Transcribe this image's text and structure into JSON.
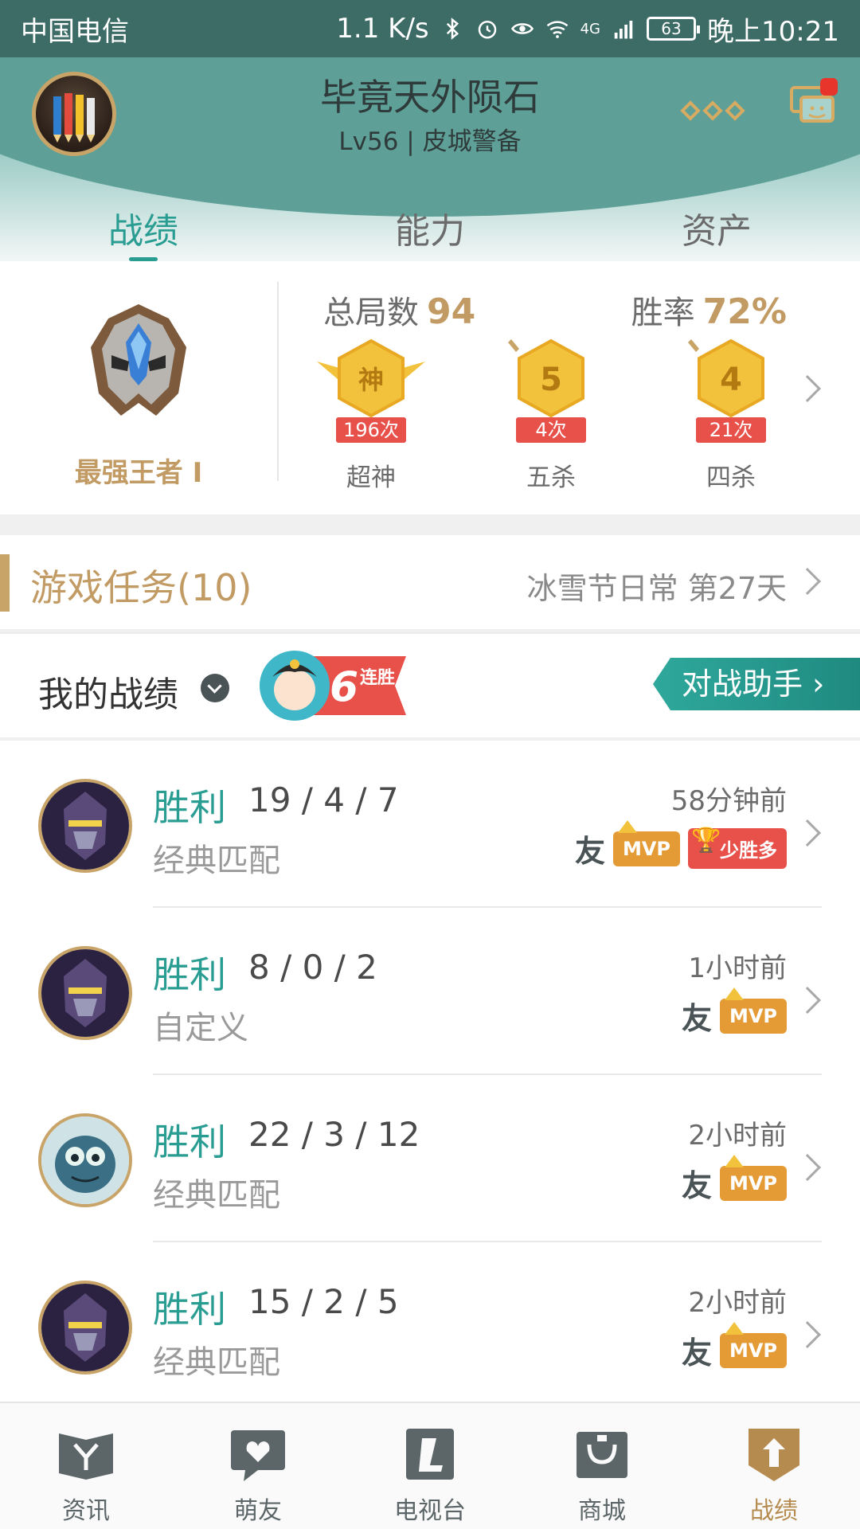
{
  "status_bar": {
    "carrier": "中国电信",
    "speed": "1.1 K/s",
    "network": "4G",
    "battery": "63",
    "time": "晚上10:21"
  },
  "header": {
    "username": "毕竟天外陨石",
    "level": "Lv56 | 皮城警备",
    "tabs": [
      {
        "label": "战绩",
        "active": true
      },
      {
        "label": "能力",
        "active": false
      },
      {
        "label": "资产",
        "active": false
      }
    ],
    "accent_color": "#2a9d92"
  },
  "summary": {
    "rank": "最强王者 I",
    "total_games_label": "总局数",
    "total_games": "94",
    "win_rate_label": "胜率",
    "win_rate": "72%",
    "badges": [
      {
        "icon": "神",
        "count": "196次",
        "label": "超神"
      },
      {
        "icon": "5",
        "count": "4次",
        "label": "五杀"
      },
      {
        "icon": "4",
        "count": "21次",
        "label": "四杀"
      }
    ]
  },
  "task": {
    "title": "游戏任务(10)",
    "info": "冰雪节日常 第27天"
  },
  "record": {
    "title": "我的战绩",
    "streak_number": "6",
    "streak_text": "连胜",
    "assistant_button": "对战助手"
  },
  "matches": [
    {
      "result": "胜利",
      "kda": "19 / 4 / 7",
      "mode": "经典匹配",
      "time": "58分钟前",
      "friend": "友",
      "mvp": "MVP",
      "extra": "少胜多",
      "hero_color": "#5a4a7a"
    },
    {
      "result": "胜利",
      "kda": "8 / 0 / 2",
      "mode": "自定义",
      "time": "1小时前",
      "friend": "友",
      "mvp": "MVP",
      "extra": "",
      "hero_color": "#5a4a7a"
    },
    {
      "result": "胜利",
      "kda": "22 / 3 / 12",
      "mode": "经典匹配",
      "time": "2小时前",
      "friend": "友",
      "mvp": "MVP",
      "extra": "",
      "hero_color": "#3a6f86"
    },
    {
      "result": "胜利",
      "kda": "15 / 2 / 5",
      "mode": "经典匹配",
      "time": "2小时前",
      "friend": "友",
      "mvp": "MVP",
      "extra": "",
      "hero_color": "#5a4a7a"
    }
  ],
  "bottom_nav": [
    {
      "label": "资讯",
      "icon": "news-icon",
      "active": false
    },
    {
      "label": "萌友",
      "icon": "friends-icon",
      "active": false
    },
    {
      "label": "电视台",
      "icon": "tv-icon",
      "active": false
    },
    {
      "label": "商城",
      "icon": "shop-icon",
      "active": false
    },
    {
      "label": "战绩",
      "icon": "record-icon",
      "active": true
    }
  ]
}
